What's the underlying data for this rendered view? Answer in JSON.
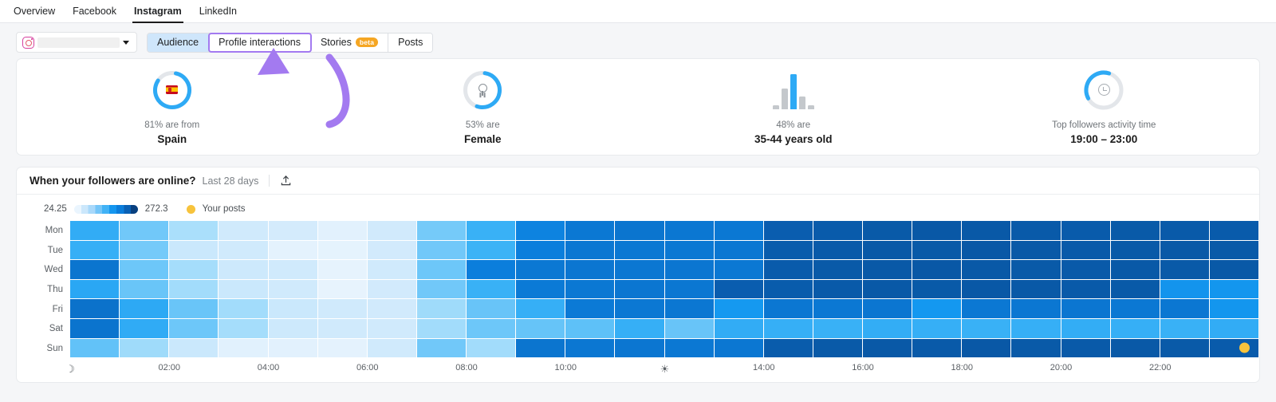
{
  "topnav": {
    "items": [
      {
        "label": "Overview",
        "active": false
      },
      {
        "label": "Facebook",
        "active": false
      },
      {
        "label": "Instagram",
        "active": true
      },
      {
        "label": "LinkedIn",
        "active": false
      }
    ]
  },
  "controls": {
    "account_select": {
      "icon": "instagram-icon",
      "value": "",
      "placeholder": ""
    },
    "tabs": [
      {
        "label": "Audience",
        "state": "selected",
        "badge": null
      },
      {
        "label": "Profile interactions",
        "state": "highlighted",
        "badge": null
      },
      {
        "label": "Stories",
        "state": "normal",
        "badge": "beta"
      },
      {
        "label": "Posts",
        "state": "normal",
        "badge": null
      }
    ]
  },
  "annotation": {
    "type": "arrow",
    "color": "#a37af0",
    "points_to": "Profile interactions"
  },
  "stats": [
    {
      "icon": "spain-flag-icon",
      "visual": "donut",
      "percent": 81,
      "sub": "81% are from",
      "main": "Spain"
    },
    {
      "icon": "female-gender-icon",
      "visual": "donut",
      "percent": 53,
      "sub": "53% are",
      "main": "Female"
    },
    {
      "icon": "age-bars-icon",
      "visual": "bars",
      "percent": 48,
      "bars": [
        8,
        26,
        44,
        17,
        7
      ],
      "highlight_index": 2,
      "sub": "48% are",
      "main": "35-44 years old"
    },
    {
      "icon": "clock-icon",
      "visual": "donut",
      "percent": 38,
      "sub": "Top followers activity time",
      "main": "19:00 – 23:00"
    }
  ],
  "heatmap_card": {
    "title": "When your followers are online?",
    "period": "Last 28 days",
    "export_icon": "export-icon",
    "legend": {
      "min": "24.25",
      "max": "272.3",
      "posts_label": "Your posts",
      "posts_color": "#f7c33c"
    }
  },
  "chart_data": {
    "type": "heatmap",
    "title": "When your followers are online?",
    "subtitle": "Last 28 days",
    "xlabel": "",
    "ylabel": "",
    "colorbar": {
      "min": 24.25,
      "max": 272.3,
      "steps": 9
    },
    "x": [
      "00:00",
      "01:00",
      "02:00",
      "03:00",
      "04:00",
      "05:00",
      "06:00",
      "07:00",
      "08:00",
      "09:00",
      "10:00",
      "11:00",
      "12:00",
      "13:00",
      "14:00",
      "15:00",
      "16:00",
      "17:00",
      "18:00",
      "19:00",
      "20:00",
      "21:00",
      "22:00",
      "23:00"
    ],
    "xtick_labels": [
      "moon-icon",
      "",
      "02:00",
      "",
      "04:00",
      "",
      "06:00",
      "",
      "08:00",
      "",
      "10:00",
      "",
      "sun-icon",
      "",
      "14:00",
      "",
      "16:00",
      "",
      "18:00",
      "",
      "20:00",
      "",
      "22:00",
      ""
    ],
    "y": [
      "Mon",
      "Tue",
      "Wed",
      "Thu",
      "Fri",
      "Sat",
      "Sun"
    ],
    "legend_position": "top-left",
    "grid": true,
    "values": [
      [
        155,
        120,
        85,
        58,
        55,
        38,
        57,
        118,
        150,
        200,
        212,
        215,
        213,
        212,
        240,
        243,
        245,
        247,
        246,
        244,
        243,
        245,
        244,
        243
      ],
      [
        152,
        118,
        62,
        58,
        36,
        35,
        56,
        120,
        148,
        205,
        213,
        212,
        212,
        213,
        242,
        244,
        246,
        245,
        247,
        246,
        244,
        245,
        246,
        245
      ],
      [
        215,
        122,
        88,
        60,
        58,
        34,
        58,
        122,
        205,
        212,
        214,
        213,
        214,
        212,
        243,
        245,
        246,
        247,
        246,
        245,
        244,
        246,
        245,
        246
      ],
      [
        160,
        124,
        90,
        62,
        58,
        33,
        56,
        120,
        150,
        210,
        212,
        214,
        213,
        240,
        242,
        244,
        246,
        245,
        247,
        246,
        244,
        245,
        180,
        178
      ],
      [
        218,
        158,
        124,
        90,
        62,
        58,
        57,
        92,
        125,
        152,
        210,
        212,
        213,
        175,
        213,
        212,
        214,
        176,
        212,
        213,
        214,
        212,
        213,
        178
      ],
      [
        216,
        156,
        122,
        88,
        60,
        58,
        58,
        90,
        122,
        126,
        130,
        152,
        125,
        155,
        152,
        150,
        154,
        152,
        150,
        152,
        154,
        152,
        150,
        155
      ],
      [
        128,
        92,
        62,
        40,
        38,
        36,
        58,
        120,
        90,
        215,
        213,
        214,
        212,
        213,
        242,
        245,
        246,
        244,
        247,
        245,
        244,
        246,
        245,
        243
      ]
    ],
    "markers": [
      {
        "day": "Sun",
        "hour": "23:00",
        "label": "Your posts",
        "color": "#f7c33c"
      }
    ]
  }
}
